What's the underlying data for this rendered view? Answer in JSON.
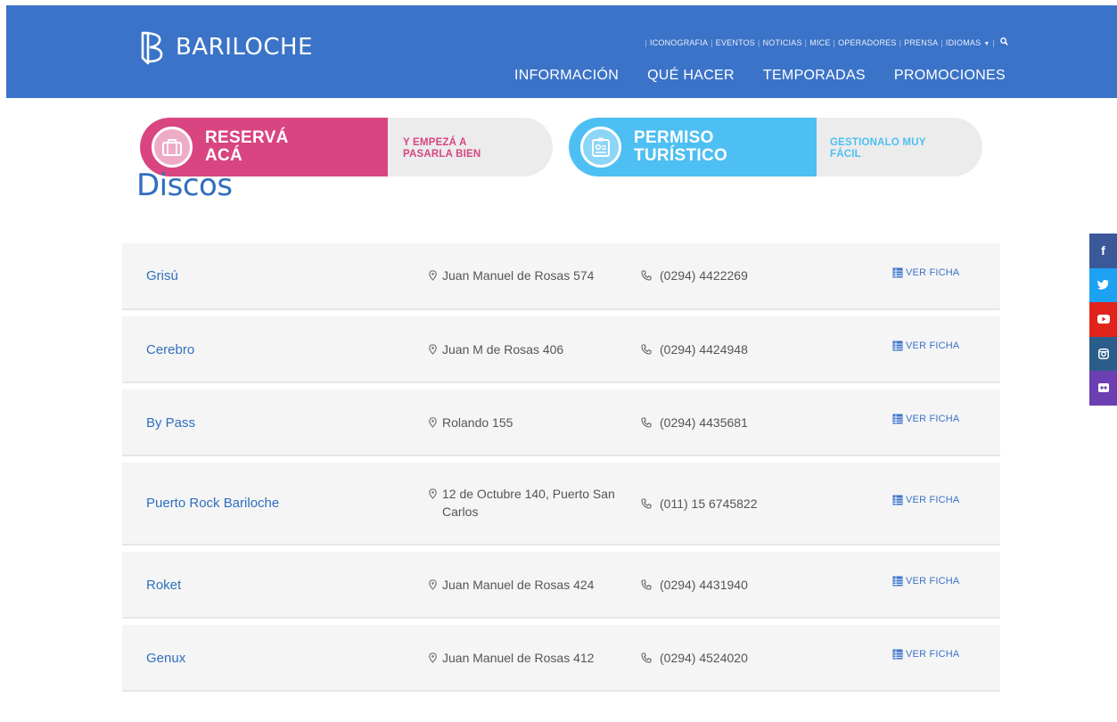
{
  "brand": {
    "name": "BARILOCHE",
    "color": "#3b73c8"
  },
  "topnav": [
    "ICONOGRAFIA",
    "EVENTOS",
    "NOTICIAS",
    "MICE",
    "OPERADORES",
    "PRENSA"
  ],
  "languages_label": "IDIOMAS",
  "mainnav": [
    "INFORMACIÓN",
    "QUÉ HACER",
    "TEMPORADAS",
    "PROMOCIONES"
  ],
  "banners": {
    "reserva": {
      "title_line1": "RESERVÁ",
      "title_line2": "ACÁ",
      "sub_line1": "Y EMPEZÁ A",
      "sub_line2": "PASARLA BIEN",
      "color": "#d94580",
      "icon": "suitcase-icon"
    },
    "permiso": {
      "title_line1": "PERMISO",
      "title_line2": "TURÍSTICO",
      "sub_line1": "GESTIONALO MUY",
      "sub_line2": "FÁCIL",
      "color": "#4ebff2",
      "icon": "id-card-icon"
    }
  },
  "page_title": "Discos",
  "ficha_label": "VER FICHA",
  "venues": [
    {
      "name": "Grisú",
      "address": "Juan Manuel de Rosas 574",
      "phone": "(0294) 4422269"
    },
    {
      "name": "Cerebro",
      "address": "Juan M de Rosas 406",
      "phone": "(0294) 4424948"
    },
    {
      "name": "By Pass",
      "address": "Rolando 155",
      "phone": "(0294) 4435681"
    },
    {
      "name": "Puerto Rock Bariloche",
      "address": "12 de Octubre 140, Puerto San Carlos",
      "phone": "(011) 15 6745822"
    },
    {
      "name": "Roket",
      "address": "Juan Manuel de Rosas 424",
      "phone": "(0294) 4431940"
    },
    {
      "name": "Genux",
      "address": "Juan Manuel de Rosas 412",
      "phone": "(0294) 4524020"
    }
  ],
  "social": [
    {
      "icon": "facebook-icon",
      "glyph": "f",
      "color": "#3b5998"
    },
    {
      "icon": "twitter-icon",
      "glyph": "t",
      "color": "#1da1f2"
    },
    {
      "icon": "youtube-icon",
      "glyph": "▶",
      "color": "#e0241b"
    },
    {
      "icon": "instagram-icon",
      "glyph": "◘",
      "color": "#2a5d8a"
    },
    {
      "icon": "flickr-icon",
      "glyph": "••",
      "color": "#6c3fb3"
    }
  ]
}
